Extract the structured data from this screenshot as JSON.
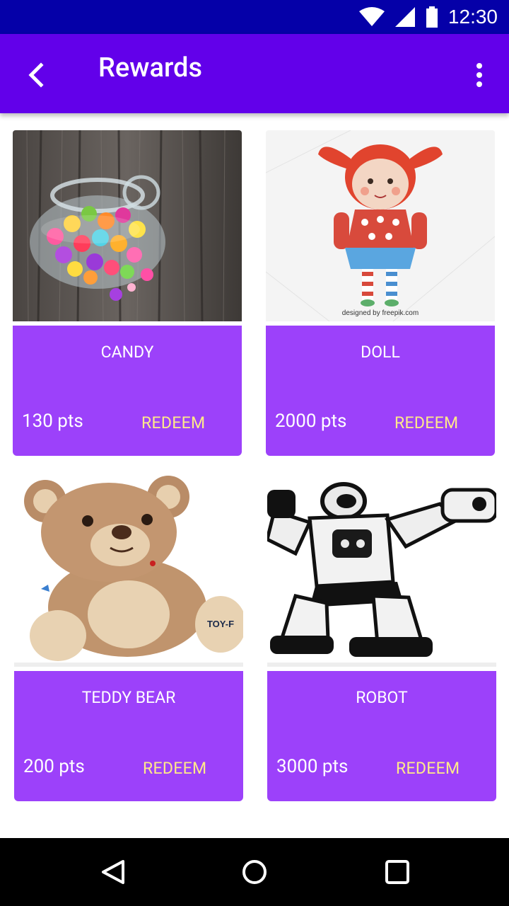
{
  "status_bar": {
    "time": "12:30",
    "icons": [
      "wifi-icon",
      "signal-icon",
      "battery-icon"
    ]
  },
  "app_bar": {
    "title": "Rewards",
    "back_icon": "chevron-left-icon",
    "menu_icon": "more-vertical-icon"
  },
  "colors": {
    "status_bar": "#0500a8",
    "app_bar": "#6200ea",
    "card_background": "#9c41fa",
    "redeem_text": "#ffe98a"
  },
  "rewards": [
    {
      "name": "CANDY",
      "points": "130 pts",
      "action": "REDEEM",
      "image": "candy-jar"
    },
    {
      "name": "DOLL",
      "points": "2000 pts",
      "action": "REDEEM",
      "image": "doll"
    },
    {
      "name": "TEDDY BEAR",
      "points": "200 pts",
      "action": "REDEEM",
      "image": "teddy-bear"
    },
    {
      "name": "ROBOT",
      "points": "3000 pts",
      "action": "REDEEM",
      "image": "robot"
    }
  ],
  "image_watermark": "designed by freepik.com",
  "teddy_tag": "TOY-F",
  "nav_bar": {
    "icons": [
      "back-triangle-icon",
      "home-circle-icon",
      "recents-square-icon"
    ]
  }
}
